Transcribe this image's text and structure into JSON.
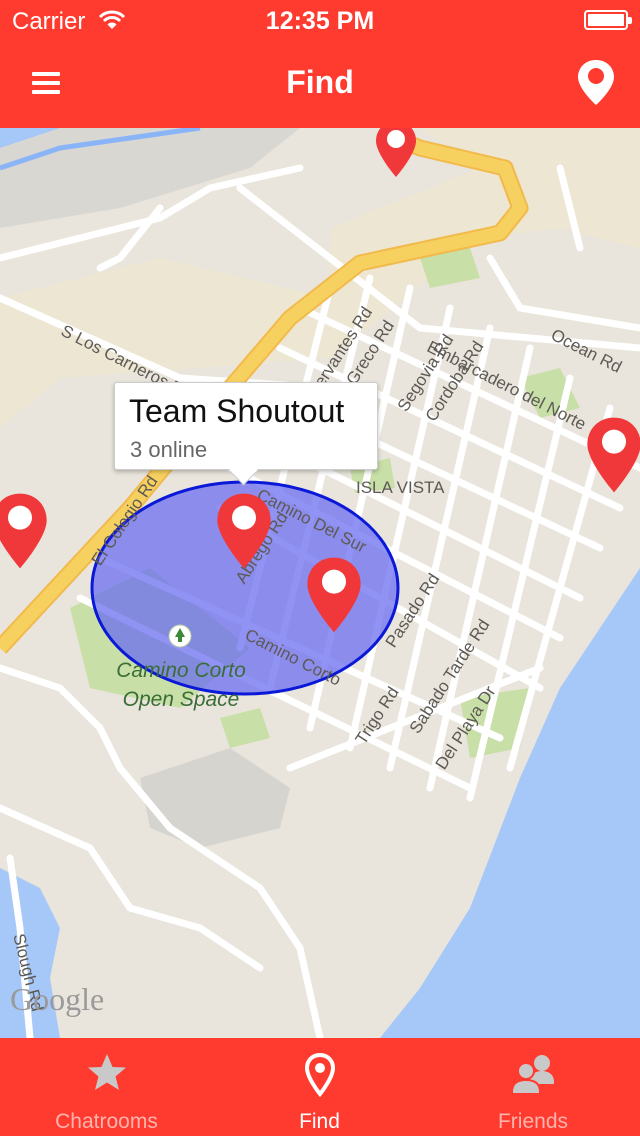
{
  "status_bar": {
    "carrier": "Carrier",
    "time": "12:35 PM"
  },
  "nav": {
    "title": "Find",
    "left_icon": "hamburger-menu-icon",
    "right_icon": "location-pin-icon"
  },
  "map": {
    "street_labels": [
      "S Los Carneros Rd",
      "Cervantes Rd",
      "El Greco Rd",
      "Segovia Rd",
      "Cordoba Rd",
      "Embarcadero del Norte",
      "Ocean Rd",
      "El Colegio Rd",
      "Camino Del Sur",
      "Abrego Rd",
      "Camino Corto",
      "Pasado Rd",
      "Trigo Rd",
      "Sabado Tarde Rd",
      "Del Playa Dr",
      "Slough Rd"
    ],
    "area_label": "ISLA VISTA",
    "park_label_line1": "Camino Corto",
    "park_label_line2": "Open Space",
    "attribution": "Google"
  },
  "callout": {
    "title": "Team Shoutout",
    "subtitle": "3 online"
  },
  "tabbar": {
    "tabs": [
      {
        "label": "Chatrooms",
        "icon": "star-icon",
        "active": false
      },
      {
        "label": "Find",
        "icon": "location-pin-icon",
        "active": true
      },
      {
        "label": "Friends",
        "icon": "people-icon",
        "active": false
      }
    ]
  },
  "colors": {
    "accent": "#ff3b30",
    "pin": "#f0383a",
    "highway": "#f6cf58",
    "water": "#a6c8f8",
    "park": "#c8dfa7",
    "radius_fill": "#6b6ef0",
    "radius_stroke": "#0a18d8"
  }
}
